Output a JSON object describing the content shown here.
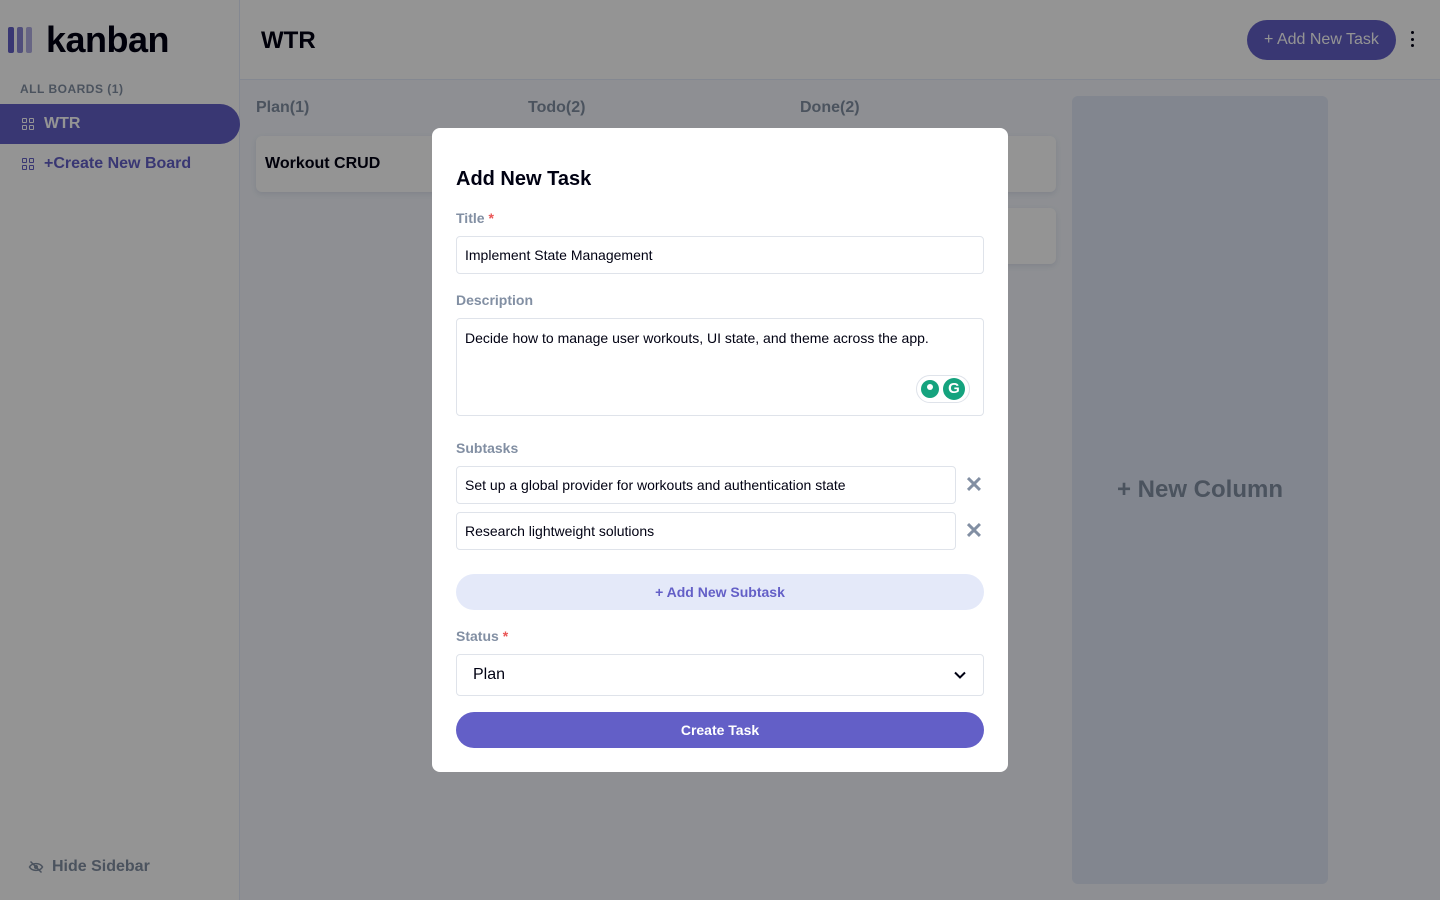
{
  "app": {
    "logo_text": "kanban",
    "brand_color": "#635fc7"
  },
  "sidebar": {
    "boards_label": "ALL BOARDS (1)",
    "boards": [
      {
        "label": "WTR",
        "active": true
      }
    ],
    "create_board_label": "+Create New Board",
    "hide_sidebar_label": "Hide Sidebar"
  },
  "header": {
    "board_title": "WTR",
    "add_task_label": "+ Add New Task"
  },
  "board": {
    "columns": [
      {
        "title": "Plan(1)",
        "tasks": [
          "Workout CRUD"
        ]
      },
      {
        "title": "Todo(2)",
        "tasks": []
      },
      {
        "title": "Done(2)",
        "tasks": []
      }
    ],
    "new_column_label": "+ New Column"
  },
  "modal": {
    "title": "Add New Task",
    "title_label": "Title",
    "required_mark": "*",
    "title_value": "Implement State Management",
    "description_label": "Description",
    "description_value": "Decide how to manage user workouts, UI state, and theme across the app.",
    "subtasks_label": "Subtasks",
    "subtasks": [
      "Set up a global provider for workouts and authentication state",
      "Research lightweight solutions"
    ],
    "add_subtask_label": "+ Add New Subtask",
    "status_label": "Status",
    "status_value": "Plan",
    "create_label": "Create Task"
  }
}
